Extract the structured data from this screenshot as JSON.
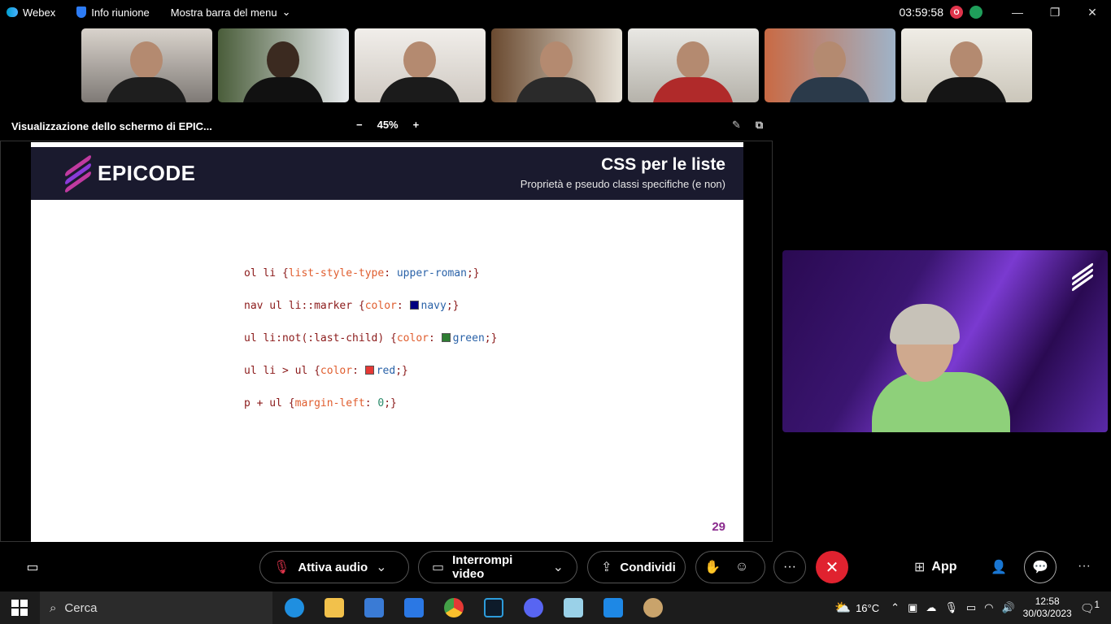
{
  "titlebar": {
    "app_name": "Webex",
    "meeting_info": "Info riunione",
    "menu_bar": "Mostra barra del menu",
    "timer": "03:59:58",
    "rec_badge": "O"
  },
  "share": {
    "title": "Visualizzazione dello schermo di EPIC...",
    "zoom": "45%",
    "zoom_minus": "−",
    "zoom_plus": "+"
  },
  "slide": {
    "brand": "EPICODE",
    "title": "CSS per le liste",
    "subtitle": "Proprietà e pseudo classi specifiche (e non)",
    "page": "29",
    "code": [
      {
        "sel": "ol li {",
        "prop": "list-style-type",
        "val": "upper-roman",
        "end": ";}"
      },
      {
        "sel": "nav ul li::marker {",
        "prop": "color",
        "val": "navy",
        "end": ";}",
        "swatch": "#000080"
      },
      {
        "sel": "ul li:not(:last-child) {",
        "prop": "color",
        "val": "green",
        "end": ";}",
        "swatch": "#2e7d32"
      },
      {
        "sel": "ul li > ul {",
        "prop": "color",
        "val": "red",
        "end": ";}",
        "swatch": "#e53935"
      },
      {
        "sel": "p + ul {",
        "prop": "margin-left",
        "val": "0",
        "end": ";}"
      }
    ]
  },
  "controls": {
    "audio": "Attiva audio",
    "video": "Interrompi video",
    "share": "Condividi",
    "app": "App",
    "more": "···"
  },
  "taskbar": {
    "search": "Cerca",
    "temp": "16°C",
    "time": "12:58",
    "date": "30/03/2023",
    "notif": "1"
  },
  "colors": {
    "accent_red": "#e0222f",
    "slide_header": "#1a1a2e",
    "page_num": "#8b2b8e"
  }
}
